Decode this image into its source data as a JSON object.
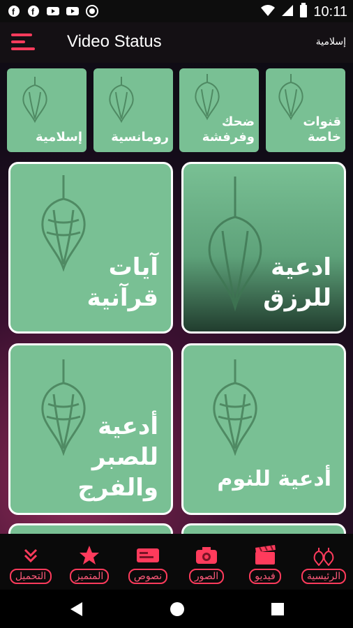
{
  "status_bar": {
    "time": "10:11",
    "left_icons": [
      "facebook-icon",
      "facebook-icon",
      "youtube-icon",
      "youtube-icon",
      "record-icon"
    ],
    "right_icons": [
      "wifi-icon",
      "cellular-icon",
      "battery-icon"
    ]
  },
  "app_bar": {
    "title": "Video Status",
    "subtitle": "إسلامية",
    "menu_icon": "hamburger-menu-icon"
  },
  "categories_small": [
    {
      "label": "إسلامية"
    },
    {
      "label": "رومانسية"
    },
    {
      "label": "ضحك وفرفشة"
    },
    {
      "label": "قنوات خاصة"
    }
  ],
  "categories_big": [
    {
      "label_line1": "آيات",
      "label_line2": "قرآنية",
      "label_line3": ""
    },
    {
      "label_line1": "ادعية",
      "label_line2": "للرزق",
      "label_line3": ""
    },
    {
      "label_line1": "أدعية",
      "label_line2": "للصبر",
      "label_line3": "والفرج"
    },
    {
      "label_line1": "أدعية للنوم",
      "label_line2": "",
      "label_line3": ""
    }
  ],
  "bottom_nav": [
    {
      "label": "التحميل",
      "icon": "download-chevrons-icon"
    },
    {
      "label": "المتميز",
      "icon": "star-icon"
    },
    {
      "label": "نصوص",
      "icon": "text-icon"
    },
    {
      "label": "الصور",
      "icon": "camera-icon"
    },
    {
      "label": "فيديو",
      "icon": "clapperboard-icon"
    },
    {
      "label": "الرئيسية",
      "icon": "leaf-home-icon"
    }
  ],
  "colors": {
    "accent": "#ff3b5c",
    "tile": "#79c094",
    "app_bar": "#141014"
  }
}
